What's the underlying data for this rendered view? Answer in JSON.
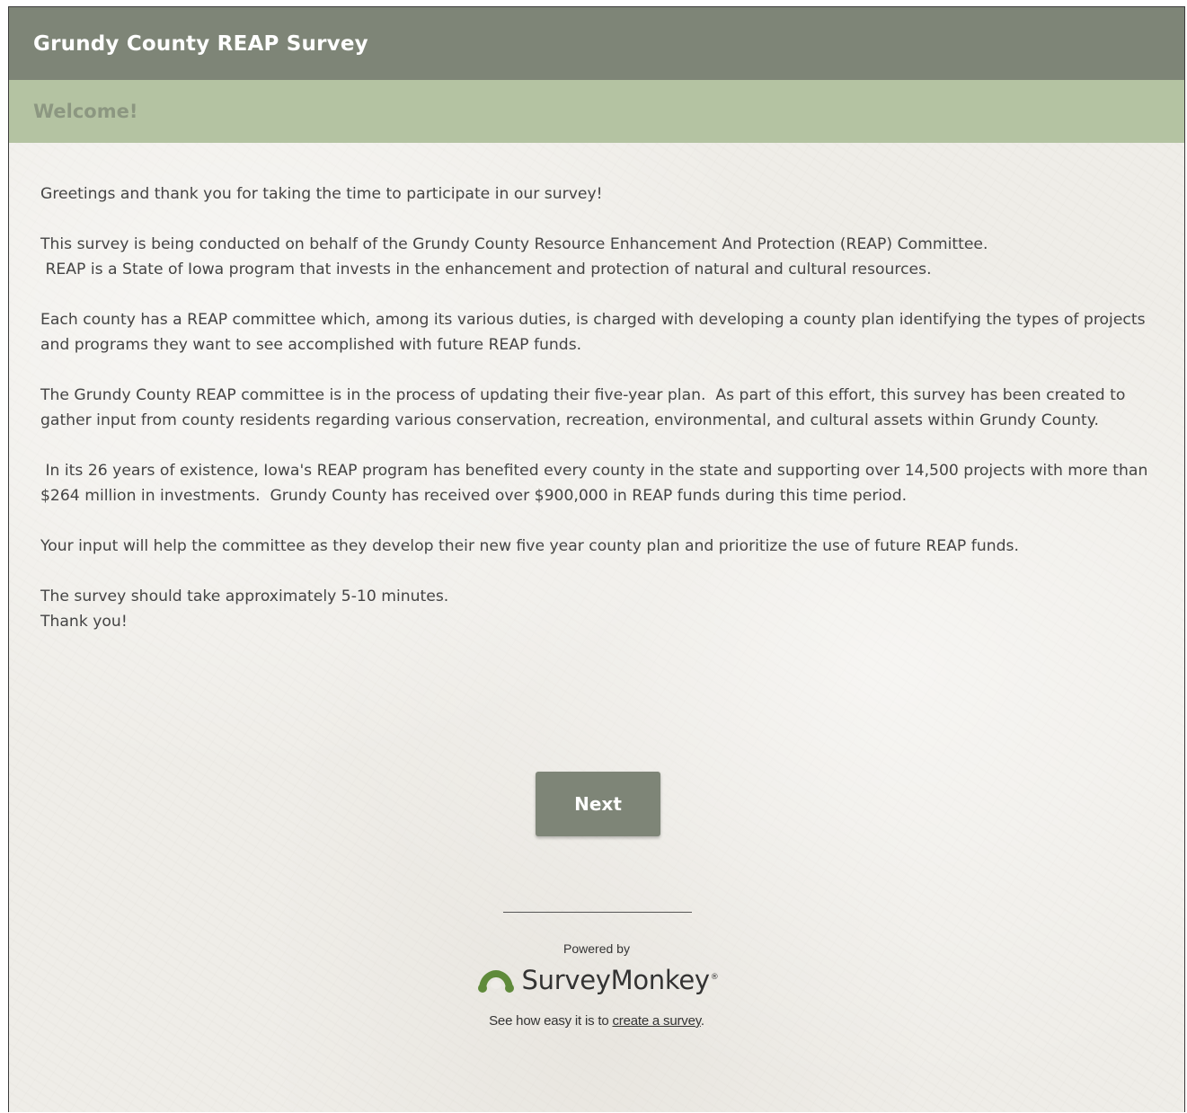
{
  "survey": {
    "title": "Grundy County REAP Survey",
    "page_title": "Welcome!"
  },
  "intro": {
    "paragraphs": [
      "Greetings and thank you for taking the time to participate in our survey!",
      "This survey is being conducted on behalf of the Grundy County Resource Enhancement And Protection (REAP) Committee.\n REAP is a State of Iowa program that invests in the enhancement and protection of natural and cultural resources.",
      "Each county has a REAP committee which, among its various duties, is charged with developing a county plan identifying the types of projects and programs they want to see accomplished with future REAP funds.",
      "The Grundy County REAP committee is in the process of updating their five-year plan.  As part of this effort, this survey has been created to gather input from county residents regarding various conservation, recreation, environmental, and cultural assets within Grundy County.",
      " In its 26 years of existence, Iowa's REAP program has benefited every county in the state and supporting over 14,500 projects with more than $264 million in investments.  Grundy County has received over $900,000 in REAP funds during this time period.",
      "Your input will help the committee as they develop their new five year county plan and prioritize the use of future REAP funds."
    ],
    "closing_line_1": "The survey should take approximately 5-10 minutes.",
    "closing_line_2": "Thank you!"
  },
  "navigation": {
    "next_label": "Next"
  },
  "footer": {
    "powered_by": "Powered by",
    "brand_name": "SurveyMonkey",
    "brand_mark": "®",
    "tagline_prefix": "See how easy it is to ",
    "tagline_link": "create a survey",
    "tagline_suffix": "."
  },
  "colors": {
    "header_bg": "#7e8577",
    "page_bar_bg": "#b4c3a2",
    "page_title_text": "#8c9781",
    "body_text": "#444444",
    "button_bg": "#7e8577",
    "logo_green": "#5f8a3a"
  },
  "icons": {
    "brand_logo": "surveymonkey-logo-icon"
  }
}
